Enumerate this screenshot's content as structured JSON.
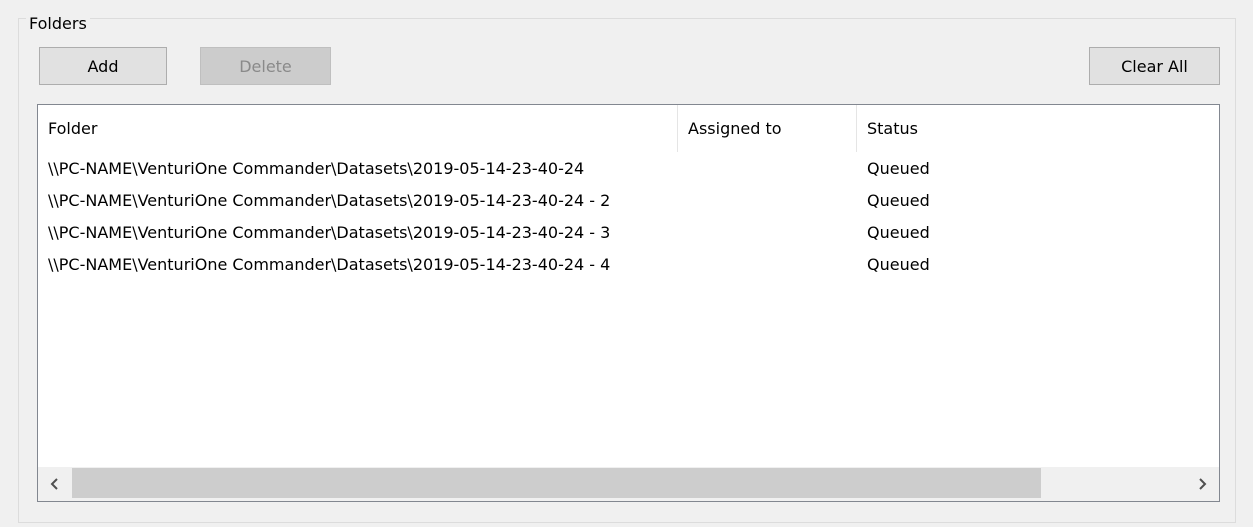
{
  "group": {
    "title": "Folders"
  },
  "toolbar": {
    "add_label": "Add",
    "delete_label": "Delete",
    "clear_all_label": "Clear All"
  },
  "list": {
    "columns": [
      "Folder",
      "Assigned to",
      "Status"
    ],
    "rows": [
      {
        "folder": "\\\\PC-NAME\\VenturiOne Commander\\Datasets\\2019-05-14-23-40-24",
        "assigned": "",
        "status": "Queued"
      },
      {
        "folder": "\\\\PC-NAME\\VenturiOne Commander\\Datasets\\2019-05-14-23-40-24 - 2",
        "assigned": "",
        "status": "Queued"
      },
      {
        "folder": "\\\\PC-NAME\\VenturiOne Commander\\Datasets\\2019-05-14-23-40-24 - 3",
        "assigned": "",
        "status": "Queued"
      },
      {
        "folder": "\\\\PC-NAME\\VenturiOne Commander\\Datasets\\2019-05-14-23-40-24 - 4",
        "assigned": "",
        "status": "Queued"
      }
    ]
  },
  "icons": {
    "scroll_left": "chevron-left-icon",
    "scroll_right": "chevron-right-icon"
  },
  "colors": {
    "window_bg": "#f0f0f0",
    "list_bg": "#ffffff",
    "disabled_button_bg": "#cccccc",
    "scroll_thumb": "#cdcdcd"
  }
}
